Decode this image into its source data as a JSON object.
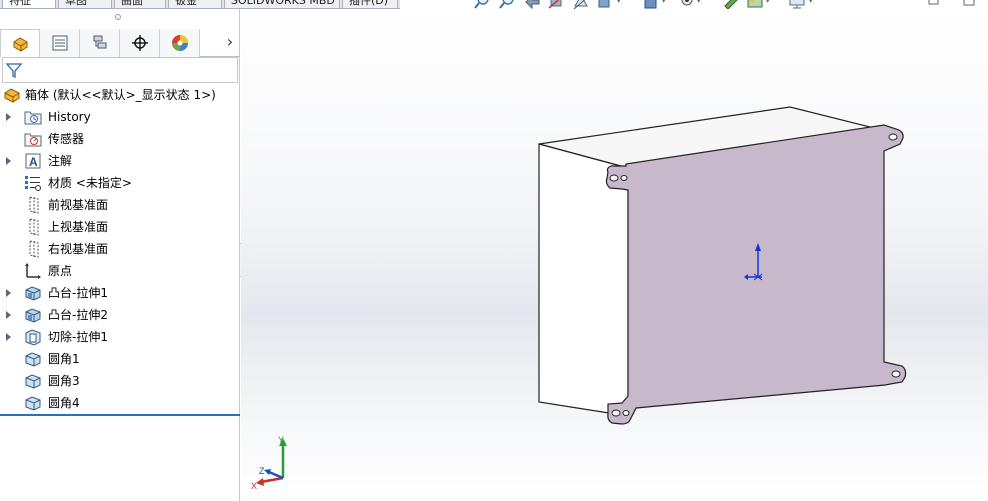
{
  "command_tabs": [
    {
      "label": "特征",
      "active": true
    },
    {
      "label": "草图",
      "active": false
    },
    {
      "label": "曲面",
      "active": false
    },
    {
      "label": "钣金",
      "active": false
    },
    {
      "label": "SOLIDWORKS MBD",
      "active": false
    },
    {
      "label": "插件(D)",
      "active": false
    }
  ],
  "view_toolbar_icons": [
    "zoom-to-fit-icon",
    "zoom-to-area-icon",
    "previous-view-icon",
    "section-view-icon",
    "dynamic-annotation-icon",
    "view-orientation-icon",
    "display-style-icon",
    "hide-show-items-icon",
    "edit-appearance-icon",
    "apply-scene-icon",
    "view-settings-icon"
  ],
  "manager_tabs": [
    "featuremanager-tab-icon",
    "propertymanager-tab-icon",
    "configurationmanager-tab-icon",
    "dimxpert-tab-icon",
    "displaymanager-tab-icon"
  ],
  "tree": {
    "root": "箱体 (默认<<默认>_显示状态 1>)",
    "items": [
      {
        "label": "History",
        "icon": "history-folder-icon",
        "expandable": true
      },
      {
        "label": "传感器",
        "icon": "sensor-icon",
        "expandable": false
      },
      {
        "label": "注解",
        "icon": "annotations-icon",
        "expandable": true
      },
      {
        "label": "材质 <未指定>",
        "icon": "material-icon",
        "expandable": false
      },
      {
        "label": "前视基准面",
        "icon": "plane-icon",
        "expandable": false
      },
      {
        "label": "上视基准面",
        "icon": "plane-icon",
        "expandable": false
      },
      {
        "label": "右视基准面",
        "icon": "plane-icon",
        "expandable": false
      },
      {
        "label": "原点",
        "icon": "origin-icon",
        "expandable": false
      },
      {
        "label": "凸台-拉伸1",
        "icon": "extrude-boss-icon",
        "expandable": true
      },
      {
        "label": "凸台-拉伸2",
        "icon": "extrude-boss-icon",
        "expandable": true
      },
      {
        "label": "切除-拉伸1",
        "icon": "extrude-cut-icon",
        "expandable": true
      },
      {
        "label": "圆角1",
        "icon": "fillet-icon",
        "expandable": false
      },
      {
        "label": "圆角3",
        "icon": "fillet-icon",
        "expandable": false
      },
      {
        "label": "圆角4",
        "icon": "fillet-icon",
        "expandable": false
      }
    ]
  },
  "triad": {
    "x": "X",
    "y": "Y",
    "z": "Z"
  },
  "colors": {
    "selected_face": "#c8b8cb",
    "accent": "#2a6ebd"
  }
}
